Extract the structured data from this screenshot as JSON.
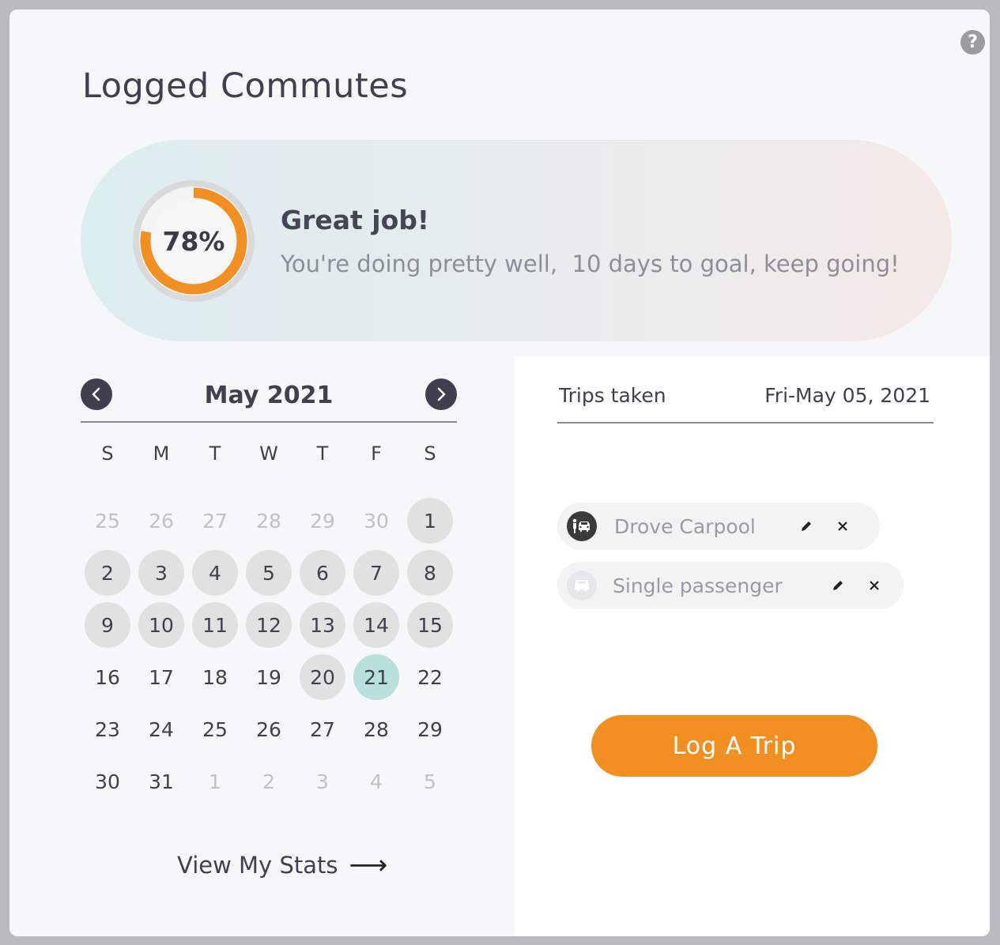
{
  "header": {
    "title": "Logged Commutes",
    "help_icon": "question-icon"
  },
  "progress": {
    "percent": 78,
    "percent_label": "78%",
    "headline": "Great job!",
    "message": "You're doing pretty well,  10 days to goal, keep going!",
    "colors": {
      "ring": "#f18f22",
      "track": "#d9d9da"
    }
  },
  "calendar": {
    "month_label": "May 2021",
    "prev_icon": "chevron-left-icon",
    "next_icon": "chevron-right-icon",
    "weekdays": [
      "S",
      "M",
      "T",
      "W",
      "T",
      "F",
      "S"
    ],
    "days": [
      {
        "label": "25",
        "state": "muted"
      },
      {
        "label": "26",
        "state": "muted"
      },
      {
        "label": "27",
        "state": "muted"
      },
      {
        "label": "28",
        "state": "muted"
      },
      {
        "label": "29",
        "state": "muted"
      },
      {
        "label": "30",
        "state": "muted"
      },
      {
        "label": "1",
        "state": "done"
      },
      {
        "label": "2",
        "state": "done"
      },
      {
        "label": "3",
        "state": "done"
      },
      {
        "label": "4",
        "state": "done"
      },
      {
        "label": "5",
        "state": "done"
      },
      {
        "label": "6",
        "state": "done"
      },
      {
        "label": "7",
        "state": "done"
      },
      {
        "label": "8",
        "state": "done"
      },
      {
        "label": "9",
        "state": "done"
      },
      {
        "label": "10",
        "state": "done"
      },
      {
        "label": "11",
        "state": "done"
      },
      {
        "label": "12",
        "state": "done"
      },
      {
        "label": "13",
        "state": "done"
      },
      {
        "label": "14",
        "state": "done"
      },
      {
        "label": "15",
        "state": "done"
      },
      {
        "label": "16",
        "state": "normal"
      },
      {
        "label": "17",
        "state": "normal"
      },
      {
        "label": "18",
        "state": "normal"
      },
      {
        "label": "19",
        "state": "normal"
      },
      {
        "label": "20",
        "state": "done"
      },
      {
        "label": "21",
        "state": "today"
      },
      {
        "label": "22",
        "state": "normal"
      },
      {
        "label": "23",
        "state": "normal"
      },
      {
        "label": "24",
        "state": "normal"
      },
      {
        "label": "25",
        "state": "normal"
      },
      {
        "label": "26",
        "state": "normal"
      },
      {
        "label": "27",
        "state": "normal"
      },
      {
        "label": "28",
        "state": "normal"
      },
      {
        "label": "29",
        "state": "normal"
      },
      {
        "label": "30",
        "state": "normal"
      },
      {
        "label": "31",
        "state": "normal"
      },
      {
        "label": "1",
        "state": "muted"
      },
      {
        "label": "2",
        "state": "muted"
      },
      {
        "label": "3",
        "state": "muted"
      },
      {
        "label": "4",
        "state": "muted"
      },
      {
        "label": "5",
        "state": "muted"
      }
    ],
    "stats_link": "View My Stats",
    "stats_icon": "arrow-right-icon"
  },
  "trips": {
    "header_label": "Trips taken",
    "date": "Fri-May 05, 2021",
    "items": [
      {
        "label": "Drove Carpool",
        "icon": "carpool-icon",
        "edit_icon": "pencil-icon",
        "delete_icon": "close-icon"
      },
      {
        "label": "Single passenger",
        "icon": "car-icon",
        "edit_icon": "pencil-icon",
        "delete_icon": "close-icon"
      }
    ],
    "log_button": "Log A Trip"
  }
}
